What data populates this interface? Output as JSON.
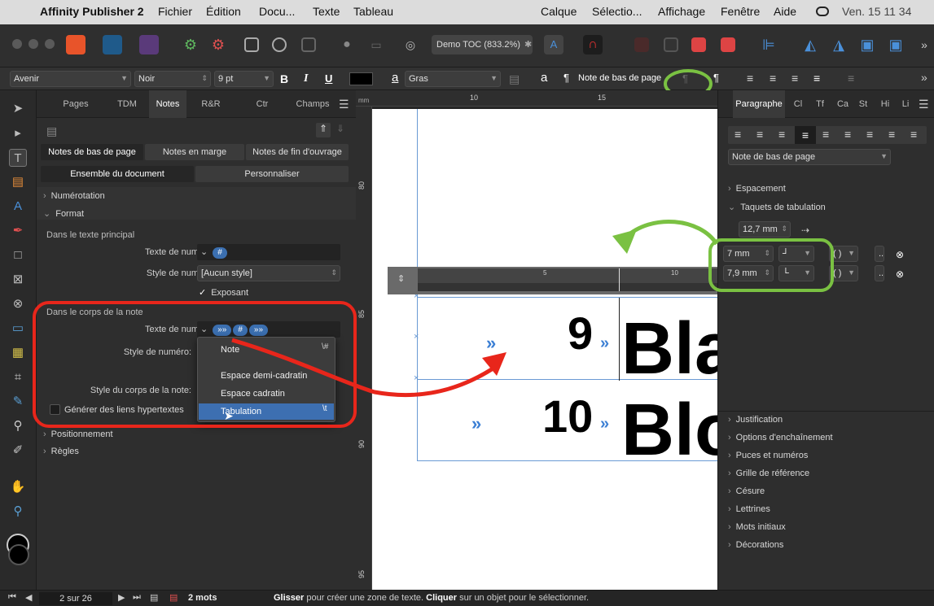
{
  "menubar": {
    "app": "Affinity Publisher 2",
    "items": [
      "Fichier",
      "Édition",
      "Docu...",
      "Texte",
      "Tableau",
      "Calque",
      "Sélectio...",
      "Affichage",
      "Fenêtre",
      "Aide"
    ],
    "clock": "Ven. 15 11 34"
  },
  "toolbar": {
    "doc_title": "Demo TOC (833.2%)",
    "doc_marker": "✱"
  },
  "context": {
    "font": "Avenir",
    "color": "Noir",
    "size": "9 pt",
    "weight": "Gras",
    "style": "Note de bas de page",
    "bold": "B",
    "italic": "I",
    "underline": "U",
    "char_a": "a",
    "pilcrow": "¶"
  },
  "left_panel": {
    "tabs": [
      "Pages",
      "TDM",
      "Notes",
      "R&R",
      "Ctr",
      "Champs"
    ],
    "note_types": [
      "Notes de bas de page",
      "Notes en marge",
      "Notes de fin d'ouvrage"
    ],
    "scope": [
      "Ensemble du document",
      "Personnaliser"
    ],
    "sections": {
      "numbering": "Numérotation",
      "format": "Format",
      "positioning": "Positionnement",
      "rules": "Règles"
    },
    "main_text": {
      "heading": "Dans le texte principal",
      "number_text_label": "Texte de numéro:",
      "number_style_label": "Style de numéro:",
      "number_style_value": "[Aucun style]",
      "superscript": "Exposant",
      "token_hash": "#"
    },
    "note_body": {
      "heading": "Dans le corps de la note",
      "number_text_label": "Texte de numéro:",
      "number_style_label": "Style de numéro:",
      "body_style_label": "Style du corps de la note:",
      "hyperlinks": "Générer des liens hypertextes",
      "tokens": [
        "»»",
        "#",
        "»»"
      ]
    },
    "popup": [
      {
        "label": "Note",
        "shortcut": "\\#"
      },
      {
        "label": "Espace demi-cadratin",
        "shortcut": ""
      },
      {
        "label": "Espace cadratin",
        "shortcut": ""
      },
      {
        "label": "Tabulation",
        "shortcut": "\\t"
      }
    ]
  },
  "canvas": {
    "ruler_h": [
      "10",
      "15"
    ],
    "ruler_v": [
      "80",
      "85",
      "90",
      "95"
    ],
    "text_ruler": [
      "5",
      "10"
    ],
    "tab_marker": "»",
    "lines": [
      {
        "number": "9",
        "word": "Bla"
      },
      {
        "number": "10",
        "word": "Blo"
      }
    ]
  },
  "right_panel": {
    "tabs": [
      "Paragraphe",
      "Cl",
      "Tf",
      "Ca",
      "St",
      "Hi",
      "Li"
    ],
    "style": "Note de bas de page",
    "sections": [
      "Espacement",
      "Taquets de tabulation"
    ],
    "default_tab": "12,7 mm",
    "tabs_list": [
      {
        "pos": "7 mm",
        "brackets": "( )",
        "dots": "..."
      },
      {
        "pos": "7,9 mm",
        "brackets": "( )",
        "dots": "..."
      }
    ],
    "more_sections": [
      "Justification",
      "Options d'enchaînement",
      "Puces et numéros",
      "Grille de référence",
      "Césure",
      "Lettrines",
      "Mots initiaux",
      "Décorations"
    ]
  },
  "status": {
    "page": "2 sur 26",
    "words": "2 mots",
    "drag": "Glisser",
    "drag_text": " pour créer une zone de texte. ",
    "click": "Cliquer",
    "click_text": " sur un objet pour le sélectionner."
  },
  "colors": {
    "accent": "#3b6fb0",
    "annotation_red": "#e8261b",
    "annotation_green": "#7ac142"
  }
}
